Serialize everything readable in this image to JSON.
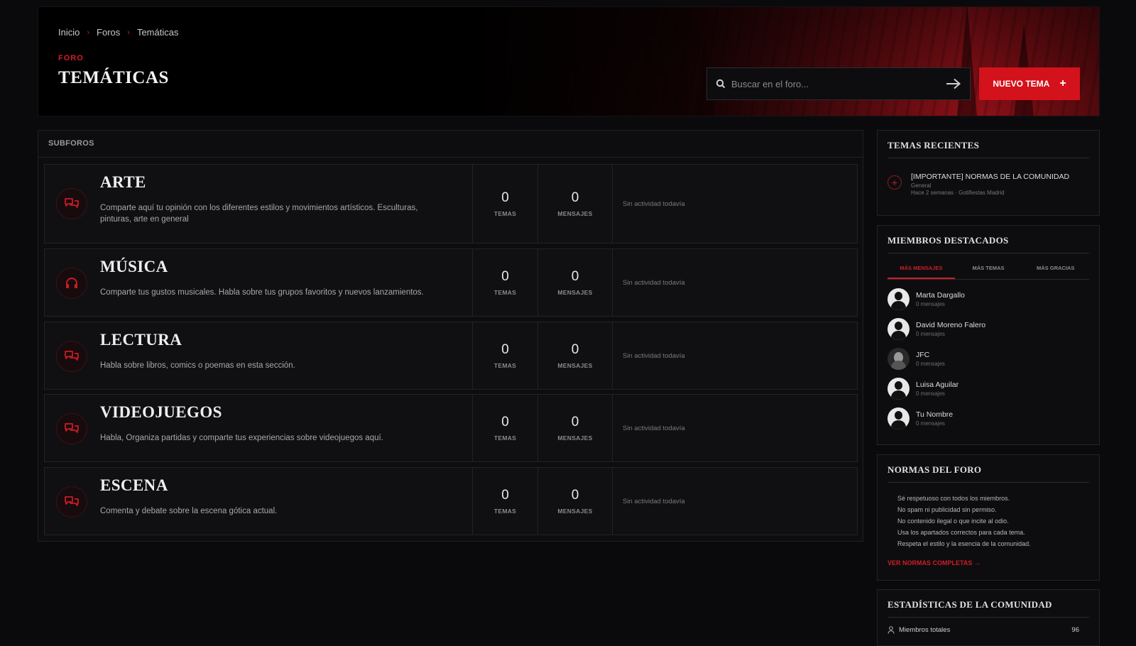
{
  "header": {
    "breadcrumb": [
      "Inicio",
      "Foros",
      "Temáticas"
    ],
    "kicker": "FORO",
    "title": "TEMÁTICAS",
    "search_placeholder": "Buscar en el foro...",
    "new_topic_label": "NUEVO TEMA",
    "accent_color": "#d4121c"
  },
  "subforums": {
    "heading": "SUBFOROS",
    "topics_label": "TEMAS",
    "messages_label": "MENSAJES",
    "items": [
      {
        "title": "ARTE",
        "desc": "Comparte aquí tu opinión con los diferentes estilos y movimientos artísticos. Esculturas, pinturas, arte en general",
        "topics": "0",
        "messages": "0",
        "last": "Sin actividad todavía",
        "icon": "chat-bubbles-icon"
      },
      {
        "title": "MÚSICA",
        "desc": "Comparte tus gustos musicales. Habla sobre tus grupos favoritos y nuevos lanzamientos.",
        "topics": "0",
        "messages": "0",
        "last": "Sin actividad todavía",
        "icon": "headphones-icon"
      },
      {
        "title": "LECTURA",
        "desc": "Habla sobre libros, comics o poemas en esta sección.",
        "topics": "0",
        "messages": "0",
        "last": "Sin actividad todavía",
        "icon": "chat-bubbles-icon"
      },
      {
        "title": "VIDEOJUEGOS",
        "desc": "Habla, Organiza partidas y comparte tus experiencias sobre videojuegos aquí.",
        "topics": "0",
        "messages": "0",
        "last": "Sin actividad todavía",
        "icon": "chat-bubbles-icon"
      },
      {
        "title": "ESCENA",
        "desc": "Comenta y debate sobre la escena gótica actual.",
        "topics": "0",
        "messages": "0",
        "last": "Sin actividad todavía",
        "icon": "chat-bubbles-icon"
      }
    ]
  },
  "recent": {
    "heading": "TEMAS RECIENTES",
    "title": "[IMPORTANTE] NORMAS DE LA COMUNIDAD",
    "category": "General",
    "meta": "Hace 2 semanas · Gotifiestas Madrid"
  },
  "members": {
    "heading": "MIEMBROS DESTACADOS",
    "tabs": [
      "MÁS MENSAJES",
      "MÁS TEMAS",
      "MÁS GRACIAS"
    ],
    "list": [
      {
        "name": "Marta Dargallo",
        "count": "0 mensajes"
      },
      {
        "name": "David Moreno Falero",
        "count": "0 mensajes"
      },
      {
        "name": "JFC",
        "count": "0 mensajes"
      },
      {
        "name": "Luisa Aguilar",
        "count": "0 mensajes"
      },
      {
        "name": "Tu Nombre",
        "count": "0 mensajes"
      }
    ]
  },
  "rules": {
    "heading": "NORMAS DEL FORO",
    "items": [
      "Sé respetuoso con todos los miembros.",
      "No spam ni publicidad sin permiso.",
      "No contenido ilegal o que incite al odio.",
      "Usa los apartados correctos para cada tema.",
      "Respeta el estilo y la esencia de la comunidad."
    ],
    "link": "VER NORMAS COMPLETAS →"
  },
  "stats": {
    "heading": "ESTADÍSTICAS DE LA COMUNIDAD",
    "total_members_label": "Miembros totales",
    "total_members_value": "96"
  }
}
